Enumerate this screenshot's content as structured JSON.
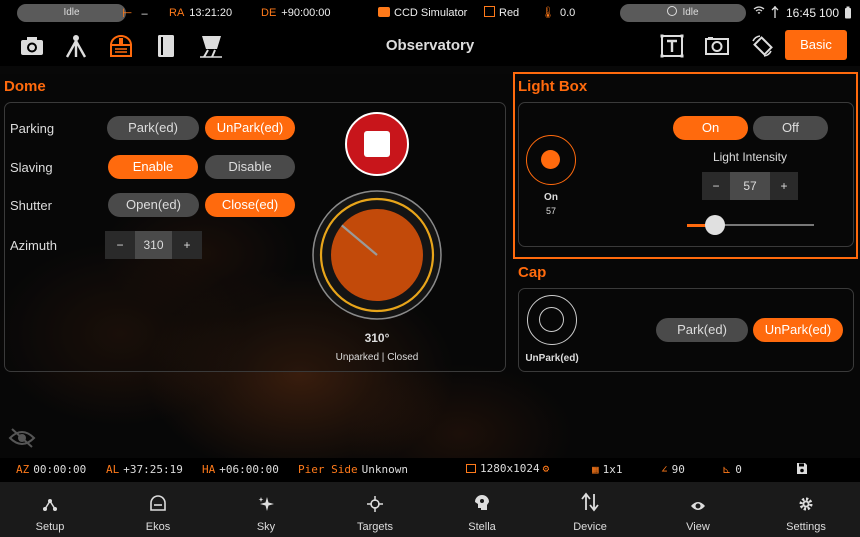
{
  "status_bar": {
    "idle_left": "Idle",
    "mount_status": "–",
    "ra_label": "RA",
    "ra_value": "13:21:20",
    "de_label": "DE",
    "de_value": "+90:00:00",
    "camera": "CCD Simulator",
    "filter": "Red",
    "temperature": "0.0",
    "idle_right": "Idle",
    "time": "16:45",
    "battery": "100"
  },
  "toolbar": {
    "title": "Observatory",
    "basic_label": "Basic"
  },
  "dome": {
    "title": "Dome",
    "parking_label": "Parking",
    "park_label": "Park(ed)",
    "unpark_label": "UnPark(ed)",
    "slaving_label": "Slaving",
    "enable_label": "Enable",
    "disable_label": "Disable",
    "shutter_label": "Shutter",
    "open_label": "Open(ed)",
    "close_label": "Close(ed)",
    "azimuth_label": "Azimuth",
    "azimuth_minus": "−",
    "azimuth_value": "310",
    "azimuth_plus": "+",
    "dial_angle_text": "310°",
    "dial_angle_deg": 310,
    "status_unparked": "Unparked",
    "status_sep": " | ",
    "status_closed": "Closed"
  },
  "light_box": {
    "title": "Light Box",
    "indicator_label": "On",
    "indicator_value": "57",
    "on_label": "On",
    "off_label": "Off",
    "intensity_label": "Light Intensity",
    "intensity_minus": "−",
    "intensity_value": "57",
    "intensity_plus": "+",
    "slider_fraction": 0.22
  },
  "cap": {
    "title": "Cap",
    "indicator_label": "UnPark(ed)",
    "park_label": "Park(ed)",
    "unpark_label": "UnPark(ed)"
  },
  "info_bar": {
    "az_label": "AZ",
    "az_value": "00:00:00",
    "al_label": "AL",
    "al_value": "+37:25:19",
    "ha_label": "HA",
    "ha_value": "+06:00:00",
    "pier_label": "Pier Side",
    "pier_value": "Unknown",
    "resolution": "1280x1024",
    "binning": "1x1",
    "angle": "90",
    "offset": "0"
  },
  "nav": {
    "items": [
      {
        "label": "Setup"
      },
      {
        "label": "Ekos"
      },
      {
        "label": "Sky"
      },
      {
        "label": "Targets"
      },
      {
        "label": "Stella"
      },
      {
        "label": "Device"
      },
      {
        "label": "View"
      },
      {
        "label": "Settings"
      }
    ]
  },
  "colors": {
    "accent": "#ff6a0d",
    "button_off": "#4a4a4a",
    "dome_red": "#c8151b",
    "dial_ring": "#e8a51a"
  }
}
